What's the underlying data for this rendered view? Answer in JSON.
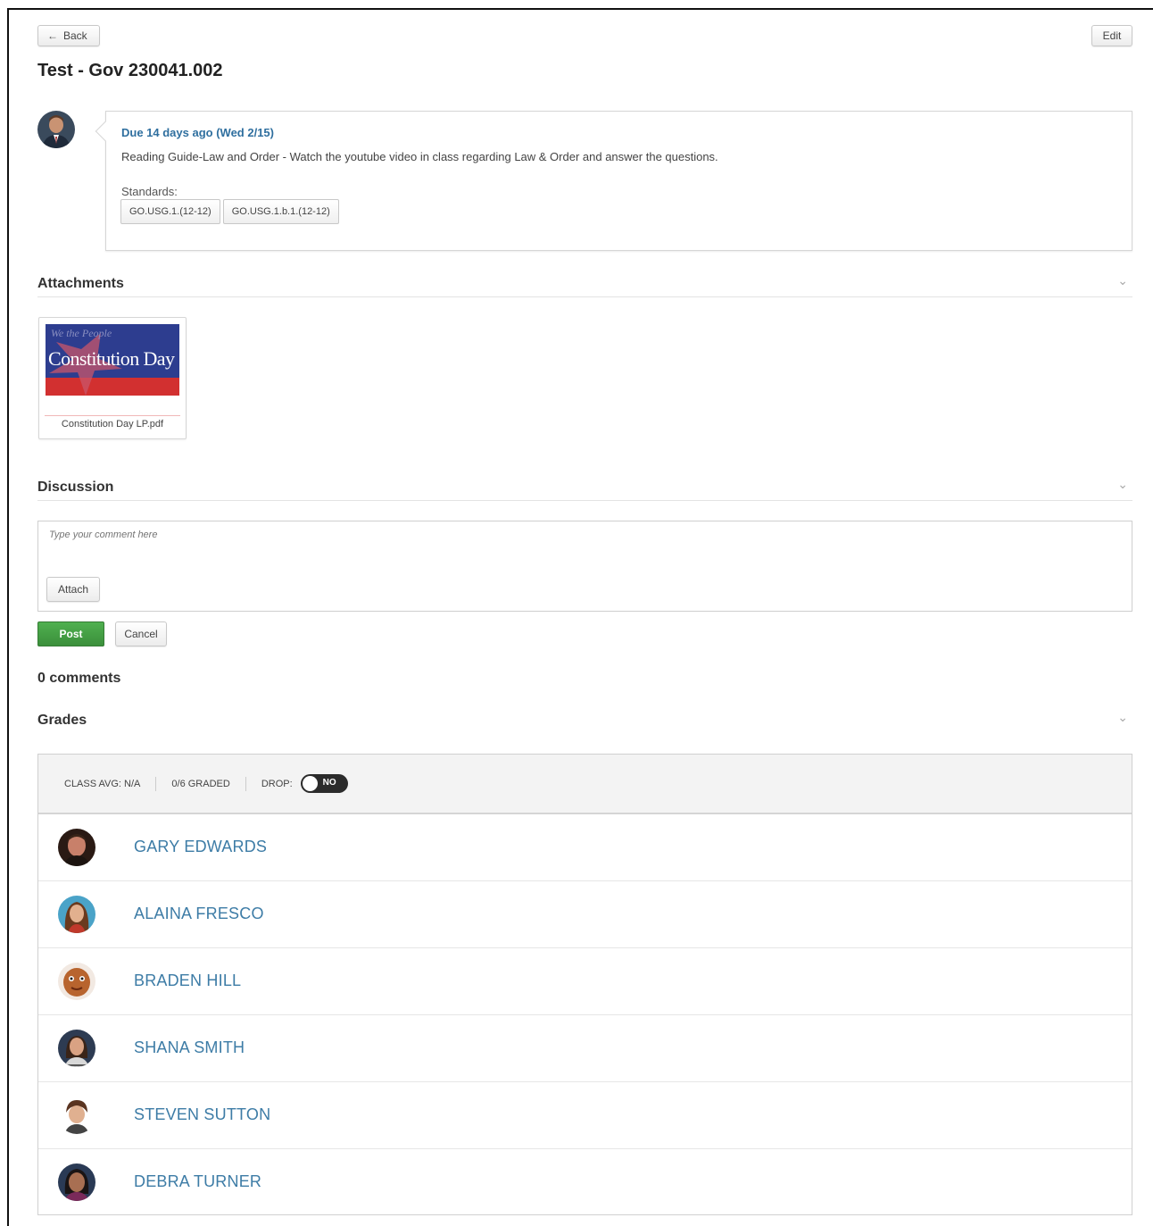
{
  "header": {
    "back_label": "Back",
    "edit_label": "Edit",
    "title": "Test - Gov 230041.002"
  },
  "assignment": {
    "due": "Due 14 days ago (Wed 2/15)",
    "description": "Reading Guide-Law and Order - Watch the youtube video in class regarding Law & Order and answer the questions.",
    "standards_label": "Standards:",
    "standards": [
      "GO.USG.1.(12-12)",
      "GO.USG.1.b.1.(12-12)"
    ]
  },
  "attachments": {
    "heading": "Attachments",
    "items": [
      {
        "filename": "Constitution Day LP.pdf",
        "thumb_small_text": "We the People",
        "thumb_title": "Constitution Day"
      }
    ]
  },
  "discussion": {
    "heading": "Discussion",
    "placeholder": "Type your comment here",
    "attach_label": "Attach",
    "post_label": "Post",
    "cancel_label": "Cancel",
    "comments_count": "0 comments"
  },
  "grades": {
    "heading": "Grades",
    "class_avg": "CLASS AVG: N/A",
    "graded": "0/6 GRADED",
    "drop_label": "DROP:",
    "drop_value": "NO",
    "students": [
      {
        "name": "GARY EDWARDS"
      },
      {
        "name": "ALAINA FRESCO"
      },
      {
        "name": "BRADEN HILL"
      },
      {
        "name": "SHANA SMITH"
      },
      {
        "name": "STEVEN SUTTON"
      },
      {
        "name": "DEBRA TURNER"
      }
    ]
  },
  "colors": {
    "link_blue": "#3d7ca6",
    "due_blue": "#2f6f9f",
    "post_green": "#3b8f3b",
    "toggle_dark": "#2b2b2b"
  },
  "icons": {
    "back": "left-arrow-icon",
    "collapse": "chevron-down-icon"
  }
}
